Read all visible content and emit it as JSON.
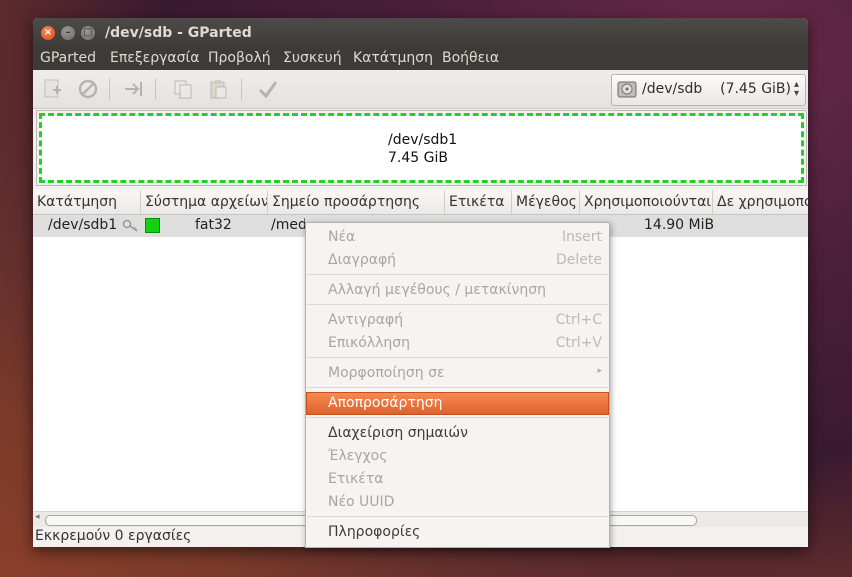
{
  "window": {
    "title": "/dev/sdb - GParted"
  },
  "menubar": {
    "items": [
      "GParted",
      "Επεξεργασία",
      "Προβολή",
      "Συσκευή",
      "Κατάτμηση",
      "Βοήθεια"
    ]
  },
  "toolbar": {
    "icons": [
      "new-icon",
      "delete-icon",
      "resize-move-icon",
      "copy-icon",
      "paste-icon",
      "apply-icon"
    ],
    "device_selector": {
      "device": "/dev/sdb",
      "size": "(7.45 GiB)"
    }
  },
  "disk_graph": {
    "partition_name": "/dev/sdb1",
    "partition_size": "7.45 GiB",
    "border_color": "#22d022"
  },
  "table": {
    "columns": [
      "Κατάτμηση",
      "Σύστημα αρχείων",
      "Σημείο προσάρτησης",
      "Ετικέτα",
      "Μέγεθος",
      "Χρησιμοποιούνται",
      "Δε χρησιμοποιούνται"
    ],
    "rows": [
      {
        "partition": "/dev/sdb1",
        "filesystem": "fat32",
        "filesystem_color": "#12d012",
        "mount_point": "/media/...",
        "label": "",
        "size": "",
        "used": "14.90 MiB",
        "unused": ""
      }
    ]
  },
  "statusbar": {
    "text": "Εκκρεμούν 0 εργασίες"
  },
  "context_menu": {
    "new": {
      "label": "Νέα",
      "shortcut": "Insert"
    },
    "delete": {
      "label": "Διαγραφή",
      "shortcut": "Delete"
    },
    "resize": {
      "label": "Αλλαγή μεγέθους / μετακίνηση"
    },
    "copy": {
      "label": "Αντιγραφή",
      "shortcut": "Ctrl+C"
    },
    "paste": {
      "label": "Επικόλληση",
      "shortcut": "Ctrl+V"
    },
    "format": {
      "label": "Μορφοποίηση σε",
      "submenu_mark": "▸"
    },
    "unmount": {
      "label": "Αποπροσάρτηση"
    },
    "manage_flags": {
      "label": "Διαχείριση σημαιών"
    },
    "check": {
      "label": "Έλεγχος"
    },
    "label": {
      "label": "Ετικέτα"
    },
    "new_uuid": {
      "label": "Νέο UUID"
    },
    "information": {
      "label": "Πληροφορίες"
    },
    "highlight_color": "#e9692c"
  }
}
